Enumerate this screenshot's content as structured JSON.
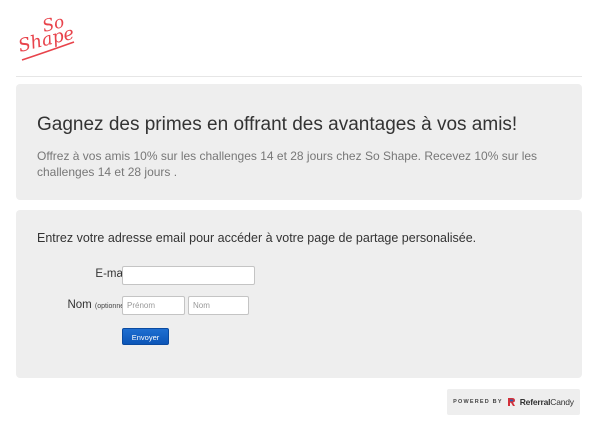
{
  "brand": {
    "logo_icon": "so-shape-logo",
    "logo_text": [
      "So",
      "Shape"
    ],
    "accent_color": "#e8434b"
  },
  "hero": {
    "title": "Gagnez des primes en offrant des avantages à vos amis!",
    "description": "Offrez à vos amis 10% sur les challenges 14 et 28 jours chez So Shape. Recevez 10% sur les challenges 14 et 28 jours ."
  },
  "form": {
    "intro": "Entrez votre adresse email pour accéder à votre page de partage personalisée.",
    "email_label": "E-mail",
    "email_value": "",
    "name_label": "Nom",
    "name_optional": "(optionnel)",
    "first_name_placeholder": "Prénom",
    "last_name_placeholder": "Nom",
    "submit_label": "Envoyer",
    "button_color": "#1565c8"
  },
  "footer": {
    "powered_by": "POWERED BY",
    "provider_bold": "Referral",
    "provider_regular": "Candy",
    "provider_icon": "referralcandy-logo-icon"
  }
}
